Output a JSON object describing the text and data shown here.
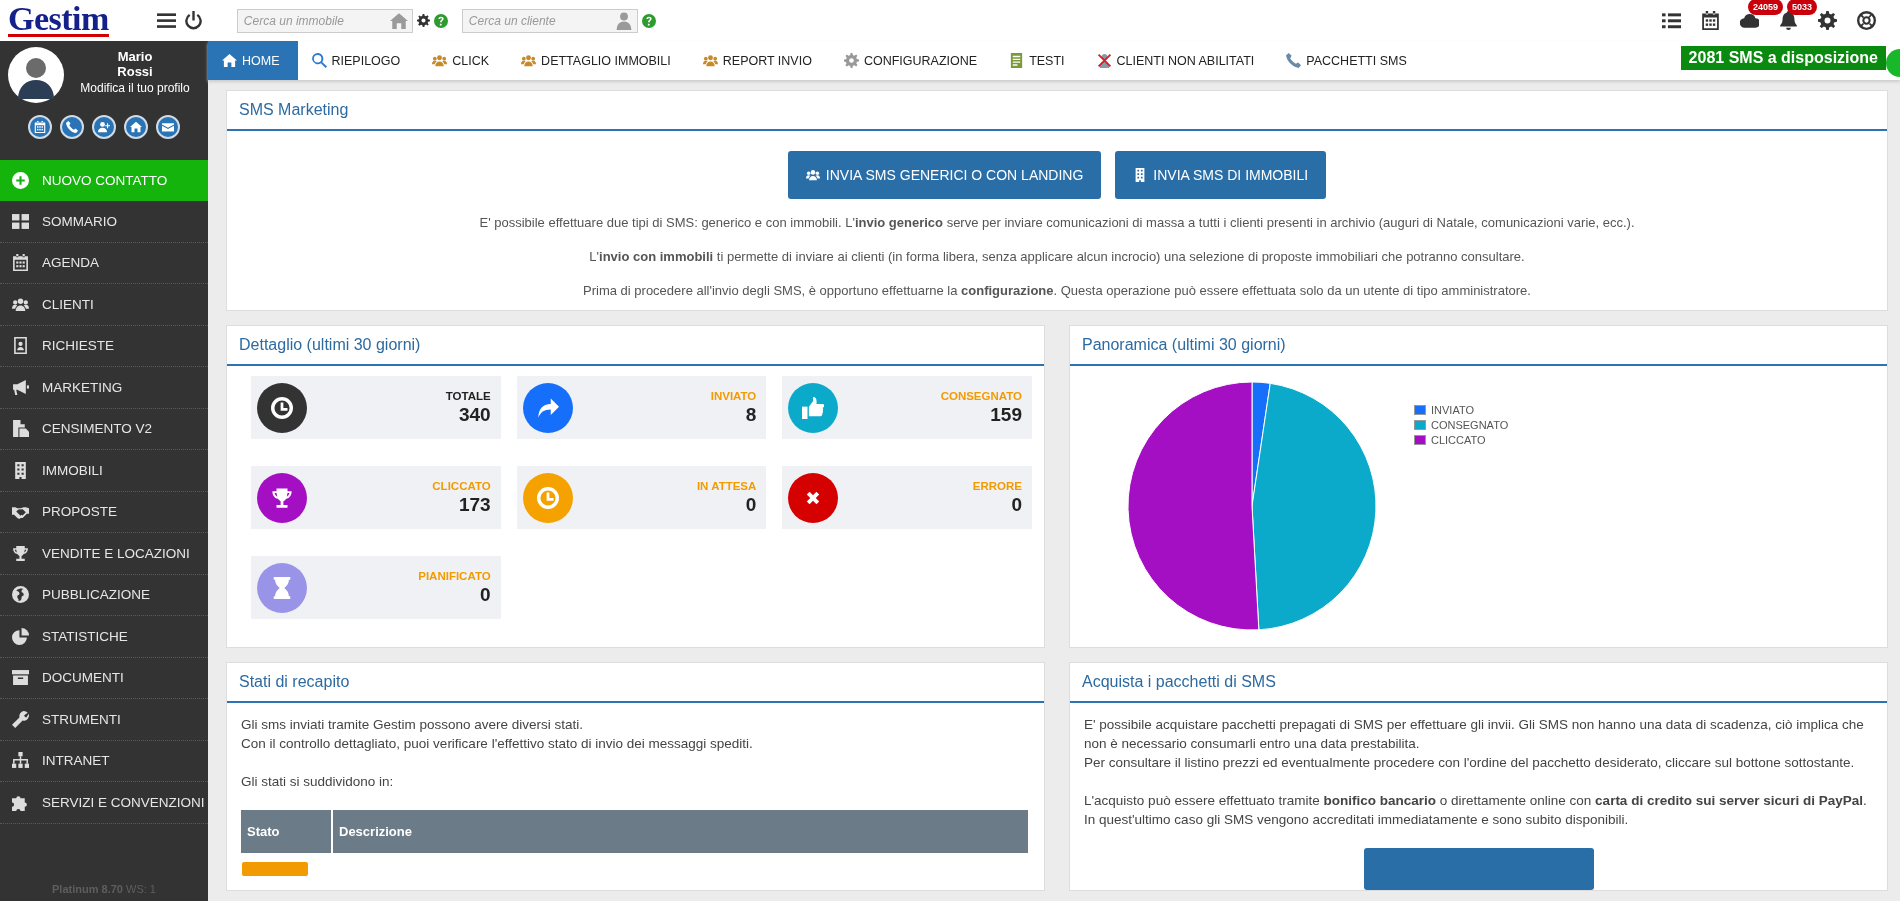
{
  "header": {
    "logo": "Gestim",
    "property_search": {
      "placeholder": "Cerca un immobile"
    },
    "client_search": {
      "placeholder": "Cerca un cliente"
    },
    "tools": [
      {
        "kind": "list"
      },
      {
        "kind": "calendar"
      },
      {
        "kind": "cloud",
        "count": "24059"
      },
      {
        "kind": "bell",
        "count": "5033"
      },
      {
        "kind": "gear"
      },
      {
        "kind": "lifebuoy"
      }
    ]
  },
  "profile": {
    "first_name": "Mario",
    "last_name": "Rossi",
    "edit_link": "Modifica il tuo profilo",
    "quick_actions": [
      {
        "kind": "calendar"
      },
      {
        "kind": "phone"
      },
      {
        "kind": "adduser"
      },
      {
        "kind": "home"
      },
      {
        "kind": "mail"
      }
    ]
  },
  "sidebar": {
    "items": [
      {
        "label": "NUOVO CONTATTO",
        "kind": "add"
      },
      {
        "label": "SOMMARIO",
        "kind": "grid"
      },
      {
        "label": "AGENDA",
        "kind": "calendar"
      },
      {
        "label": "CLIENTI",
        "kind": "people"
      },
      {
        "label": "RICHIESTE",
        "kind": "card"
      },
      {
        "label": "MARKETING",
        "kind": "megaphone"
      },
      {
        "label": "CENSIMENTO V2",
        "kind": "document"
      },
      {
        "label": "IMMOBILI",
        "kind": "building"
      },
      {
        "label": "PROPOSTE",
        "kind": "handshake"
      },
      {
        "label": "VENDITE E LOCAZIONI",
        "kind": "trophy"
      },
      {
        "label": "PUBBLICAZIONE",
        "kind": "globe"
      },
      {
        "label": "STATISTICHE",
        "kind": "pie"
      },
      {
        "label": "DOCUMENTI",
        "kind": "archive"
      },
      {
        "label": "STRUMENTI",
        "kind": "wrench"
      },
      {
        "label": "INTRANET",
        "kind": "sitemap"
      },
      {
        "label": "SERVIZI E CONVENZIONI",
        "kind": "puzzle"
      }
    ],
    "footer": "**Platinum 8.70** WS: 1"
  },
  "nav": {
    "tabs": [
      {
        "label": "HOME",
        "kind": "home",
        "selected": true
      },
      {
        "label": "RIEPILOGO",
        "kind": "search",
        "selected": false
      },
      {
        "label": "CLICK",
        "kind": "people",
        "selected": false
      },
      {
        "label": "DETTAGLIO IMMOBILI",
        "kind": "people",
        "selected": false
      },
      {
        "label": "REPORT INVIO",
        "kind": "people",
        "selected": false
      },
      {
        "label": "CONFIGURAZIONE",
        "kind": "gear",
        "selected": false
      },
      {
        "label": "TESTI",
        "kind": "notes",
        "selected": false
      },
      {
        "label": "CLIENTI NON ABILITATI",
        "kind": "blocked",
        "selected": false
      },
      {
        "label": "PACCHETTI SMS",
        "kind": "phone",
        "selected": false
      }
    ],
    "sms_available": "2081 SMS a disposizione"
  },
  "sms_marketing": {
    "title": "SMS Marketing",
    "buttons": [
      {
        "label": "INVIA SMS GENERICI O CON LANDING",
        "kind": "people"
      },
      {
        "label": "INVIA SMS DI IMMOBILI",
        "kind": "building"
      }
    ],
    "paragraphs": [
      "E' possibile effettuare due tipi di SMS: generico e con immobili. L'**invio generico** serve per inviare comunicazioni di massa a tutti i clienti presenti in archivio (auguri di Natale, comunicazioni varie, ecc.).",
      "L'**invio con immobili** ti permette di inviare ai clienti (in forma libera, senza applicare alcun incrocio) una selezione di proposte immobiliari che potranno consultare.",
      "Prima di procedere all'invio degli SMS, è opportuno effettuarne la **configurazione**. Questa operazione può essere effettuata solo da un utente di tipo amministratore."
    ]
  },
  "detail": {
    "title": "Dettaglio (ultimi 30 giorni)",
    "stats": [
      {
        "label": "TOTALE",
        "value": "340",
        "kind": "clock",
        "color": "#333333",
        "accent": false
      },
      {
        "label": "INVIATO",
        "value": "8",
        "kind": "share",
        "color": "#166ffa",
        "accent": true
      },
      {
        "label": "CONSEGNATO",
        "value": "159",
        "kind": "thumb",
        "color": "#0baacb",
        "accent": true
      },
      {
        "label": "CLICCATO",
        "value": "173",
        "kind": "trophy",
        "color": "#a50fc4",
        "accent": true
      },
      {
        "label": "IN ATTESA",
        "value": "0",
        "kind": "clock",
        "color": "#f5a100",
        "accent": true
      },
      {
        "label": "ERRORE",
        "value": "0",
        "kind": "error",
        "color": "#d50000",
        "accent": true
      },
      {
        "label": "PIANIFICATO",
        "value": "0",
        "kind": "hourglass",
        "color": "#9a94e8",
        "accent": true
      }
    ]
  },
  "overview": {
    "title": "Panoramica (ultimi 30 giorni)",
    "chart_data": {
      "type": "pie",
      "categories": [
        "INVIATO",
        "CONSEGNATO",
        "CLICCATO"
      ],
      "values": [
        2.35,
        46.77,
        50.88
      ],
      "colors": [
        "#166ffa",
        "#0baacb",
        "#a50fc4"
      ]
    }
  },
  "delivery_states": {
    "title": "Stati di recapito",
    "blocks": [
      [
        "Gli sms inviati tramite Gestim possono avere diversi stati.",
        "Con il controllo dettagliato, puoi verificare l'effettivo stato di invio dei messaggi spediti."
      ],
      [
        "Gli stati si suddividono in:"
      ]
    ],
    "table": {
      "columns": [
        "Stato",
        "Descrizione"
      ],
      "rows": [
        {
          "kind": "badge"
        }
      ]
    }
  },
  "purchase": {
    "title": "Acquista i pacchetti di SMS",
    "blocks": [
      [
        "E' possibile acquistare pacchetti prepagati di SMS per effettuare gli invii. Gli SMS non hanno una data di scadenza, ciò implica che non è necessario consumarli entro una data prestabilita.",
        "Per consultare il listino prezzi ed eventualmente procedere con l'ordine del pacchetto desiderato, cliccare sul bottone sottostante."
      ],
      [
        "L'acquisto può essere effettuato tramite **bonifico bancario** o direttamente online con **carta di credito sui server sicuri di PayPal**. In quest'ultimo caso gli SMS vengono accreditati immediatamente e sono subito disponibili."
      ]
    ],
    "has_button": true
  }
}
